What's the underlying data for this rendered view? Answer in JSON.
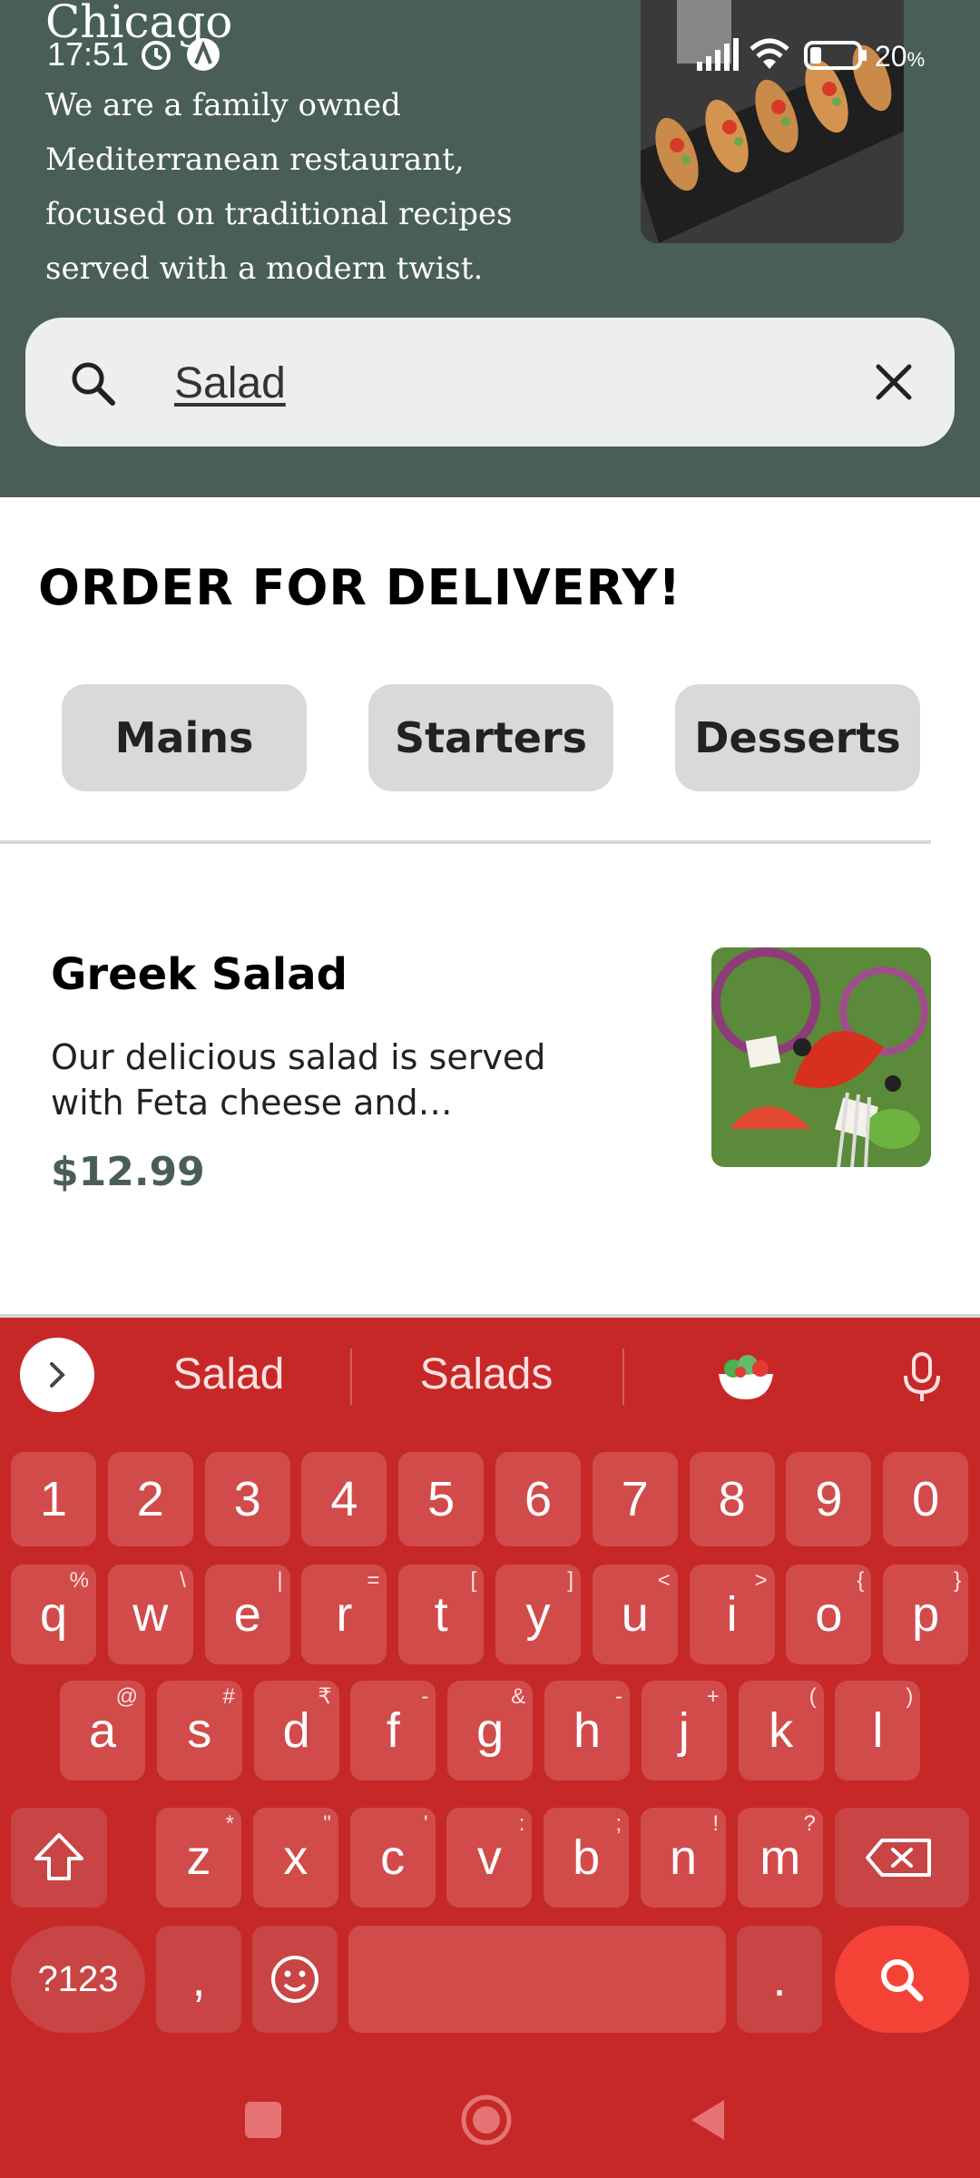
{
  "hero": {
    "title": "Chicago",
    "description": "We are a family owned Mediterranean restaurant, focused on traditional recipes served with a modern twist."
  },
  "status_bar": {
    "time": "17:51",
    "battery": "20",
    "battery_unit": "%"
  },
  "search": {
    "value": "Salad",
    "icon": "search-icon",
    "clear_icon": "close-icon"
  },
  "delivery": {
    "title": "ORDER FOR DELIVERY!",
    "categories": [
      "Mains",
      "Starters",
      "Desserts"
    ]
  },
  "menu_items": [
    {
      "title": "Greek Salad",
      "description": "Our delicious salad is served with Feta cheese and…",
      "price": "$12.99"
    }
  ],
  "keyboard": {
    "suggestions": [
      "Salad",
      "Salads"
    ],
    "number_row": [
      "1",
      "2",
      "3",
      "4",
      "5",
      "6",
      "7",
      "8",
      "9",
      "0"
    ],
    "row1": [
      {
        "k": "q",
        "s": "%"
      },
      {
        "k": "w",
        "s": "\\"
      },
      {
        "k": "e",
        "s": "|"
      },
      {
        "k": "r",
        "s": "="
      },
      {
        "k": "t",
        "s": "["
      },
      {
        "k": "y",
        "s": "]"
      },
      {
        "k": "u",
        "s": "<"
      },
      {
        "k": "i",
        "s": ">"
      },
      {
        "k": "o",
        "s": "{"
      },
      {
        "k": "p",
        "s": "}"
      }
    ],
    "row2": [
      {
        "k": "a",
        "s": "@"
      },
      {
        "k": "s",
        "s": "#"
      },
      {
        "k": "d",
        "s": "₹"
      },
      {
        "k": "f",
        "s": "-"
      },
      {
        "k": "g",
        "s": "&"
      },
      {
        "k": "h",
        "s": "-"
      },
      {
        "k": "j",
        "s": "+"
      },
      {
        "k": "k",
        "s": "("
      },
      {
        "k": "l",
        "s": ")"
      }
    ],
    "row3": [
      {
        "k": "z",
        "s": "*"
      },
      {
        "k": "x",
        "s": "\""
      },
      {
        "k": "c",
        "s": "'"
      },
      {
        "k": "v",
        "s": ":"
      },
      {
        "k": "b",
        "s": ";"
      },
      {
        "k": "n",
        "s": "!"
      },
      {
        "k": "m",
        "s": "?"
      }
    ],
    "symbols_label": "?123",
    "comma": ",",
    "period": "."
  },
  "colors": {
    "hero_bg": "#495E57",
    "keyboard_bg": "#C62828",
    "key_bg": "#D24B4B",
    "search_key": "#F44336",
    "price": "#495E57"
  }
}
